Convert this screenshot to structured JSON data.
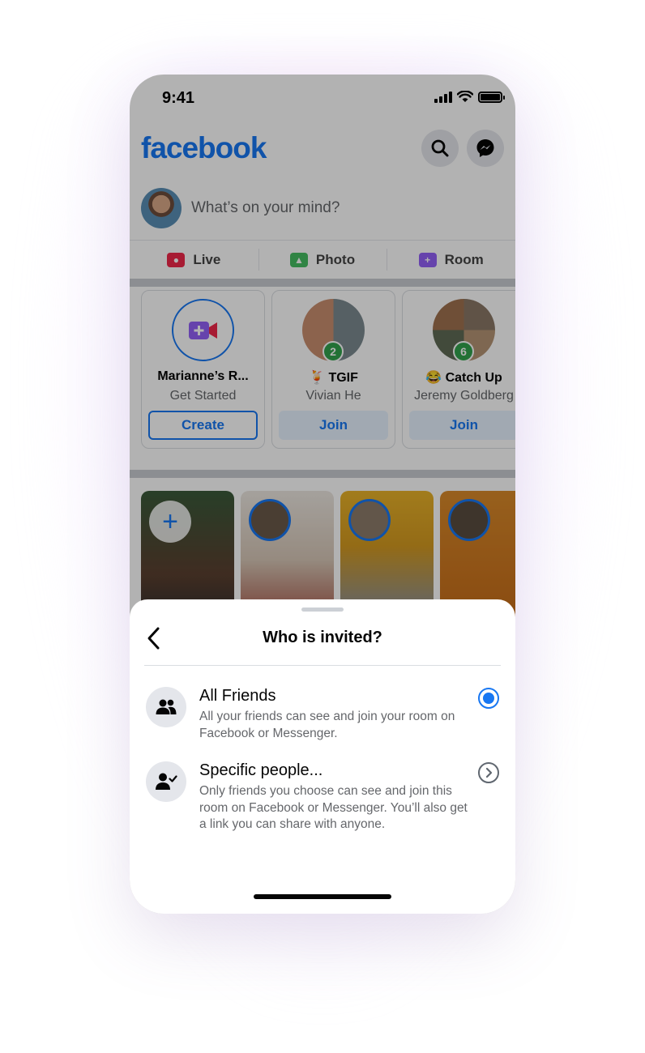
{
  "status_bar": {
    "time": "9:41"
  },
  "header": {
    "logo": "facebook",
    "icons": [
      "search-icon",
      "messenger-icon"
    ]
  },
  "composer": {
    "placeholder": "What’s on your mind?"
  },
  "actions": [
    {
      "label": "Live",
      "icon": "live-video-icon",
      "color": "#f02849"
    },
    {
      "label": "Photo",
      "icon": "photo-icon",
      "color": "#45bd62"
    },
    {
      "label": "Room",
      "icon": "room-icon",
      "color": "#9360f7"
    }
  ],
  "rooms": [
    {
      "title": "Marianne’s R...",
      "subtitle": "Get Started",
      "button": "Create"
    },
    {
      "title": "🍹 TGIF",
      "subtitle": "Vivian He",
      "button": "Join",
      "badge": "2"
    },
    {
      "title": "😂 Catch Up",
      "subtitle": "Jeremy Goldberg",
      "button": "Join",
      "badge": "6"
    }
  ],
  "stories": {
    "add_label": "+"
  },
  "sheet": {
    "title": "Who is invited?",
    "options": [
      {
        "title": "All Friends",
        "description": "All your friends can see and join your room on Facebook or Messenger.",
        "selected": true
      },
      {
        "title": "Specific people...",
        "description": "Only friends you choose can see and join this room on Facebook or Messenger. You’ll also get a link you can share with anyone.",
        "selected": false
      }
    ]
  },
  "colors": {
    "brand": "#1877f2",
    "text": "#050505",
    "secondary": "#65676b"
  }
}
